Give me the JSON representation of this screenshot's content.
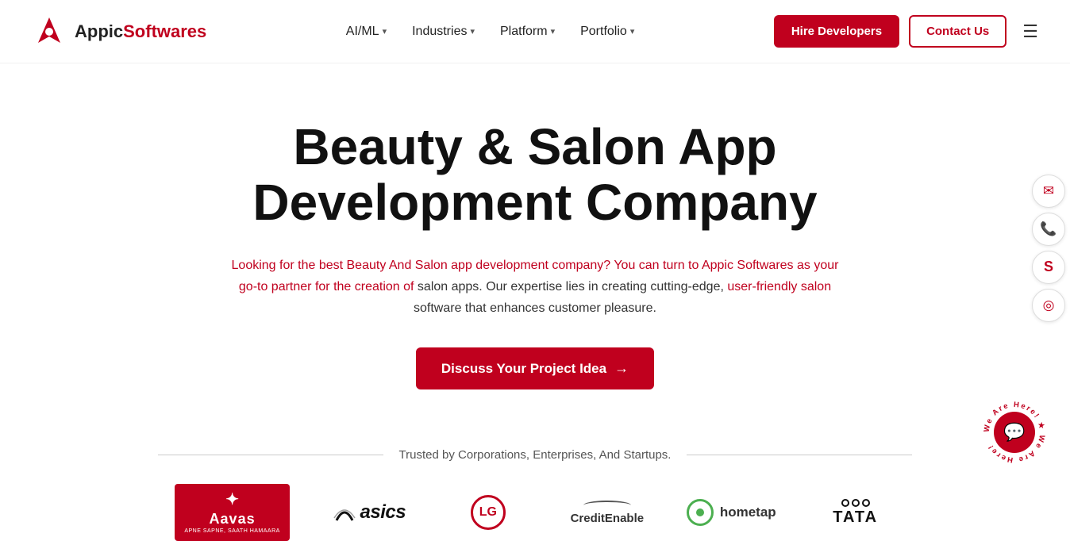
{
  "navbar": {
    "logo_text_appic": "Appic",
    "logo_text_softwares": "Softwares",
    "nav_items": [
      {
        "label": "AI/ML",
        "has_dropdown": true
      },
      {
        "label": "Industries",
        "has_dropdown": true
      },
      {
        "label": "Platform",
        "has_dropdown": true
      },
      {
        "label": "Portfolio",
        "has_dropdown": true
      }
    ],
    "hire_btn": "Hire Developers",
    "contact_btn": "Contact Us"
  },
  "hero": {
    "title_line1": "Beauty & Salon App",
    "title_line2": "Development Company",
    "description": "Looking for the best Beauty And Salon app development company? You can turn to Appic Softwares as your go-to partner for the creation of salon apps. Our expertise lies in creating cutting-edge, user-friendly salon software that enhances customer pleasure.",
    "cta_button": "Discuss Your Project Idea",
    "cta_arrow": "→"
  },
  "trusted": {
    "text": "Trusted by Corporations, Enterprises, And Startups.",
    "logos": [
      {
        "name": "Aavas Financiers",
        "key": "aavas"
      },
      {
        "name": "ASICS",
        "key": "asics"
      },
      {
        "name": "LG",
        "key": "lg"
      },
      {
        "name": "CreditEnable",
        "key": "creditenable"
      },
      {
        "name": "Hometap",
        "key": "hometap"
      },
      {
        "name": "TATA",
        "key": "tata"
      }
    ]
  },
  "side_icons": [
    {
      "name": "email",
      "symbol": "✉"
    },
    {
      "name": "phone",
      "symbol": "📞"
    },
    {
      "name": "skype",
      "symbol": "S"
    },
    {
      "name": "whatsapp",
      "symbol": "◎"
    }
  ],
  "we_are_here": {
    "label": "We Are Here!",
    "chat_icon": "💬"
  },
  "colors": {
    "primary": "#c0001e",
    "dark": "#111",
    "text": "#333"
  }
}
